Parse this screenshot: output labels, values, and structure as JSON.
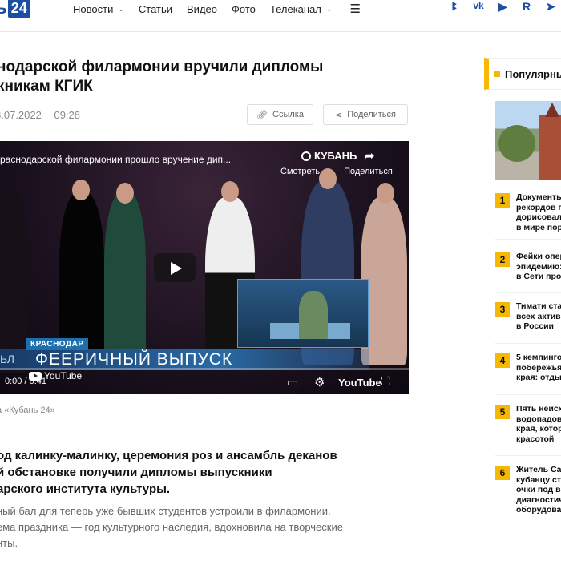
{
  "header": {
    "logo_text": "ь",
    "logo_badge": "24",
    "nav": [
      {
        "label": "Новости",
        "dropdown": true
      },
      {
        "label": "Статьи",
        "dropdown": false
      },
      {
        "label": "Видео",
        "dropdown": false
      },
      {
        "label": "Фото",
        "dropdown": false
      },
      {
        "label": "Телеканал",
        "dropdown": true
      }
    ],
    "burger": "☰",
    "socials": [
      "ok",
      "vk",
      "▶",
      "R",
      "tg"
    ]
  },
  "article": {
    "title_line1": "нодарской филармонии вручили дипломы",
    "title_line2": "кникам КГИК",
    "date": "8.07.2022",
    "time": "09:28",
    "link_button": "Ссылка",
    "share_button": "Поделиться",
    "caption": "а «Кубань 24»",
    "lead_line1": "од калинку-малинку, церемония роз и ансамбль деканов",
    "lead_line2": "й обстановке получили дипломы выпускники",
    "lead_line3": "арского института культуры.",
    "body_line1": "ный бал для теперь уже бывших студентов устроили в филармонии.",
    "body_line2": "ема праздника — год культурного наследия, вдохновила на творческие",
    "body_line3": "нты."
  },
  "video": {
    "title": "раснодарской филармонии прошло вручение дип...",
    "brand": "КУБАНЬ",
    "watch_label": "Смотреть",
    "share_label": "Поделиться",
    "lower_city": "КРАСНОДАР",
    "lower_prefix": "ЬЛ",
    "lower_headline": "ФЕЕРИЧНЫЙ ВЫПУСК",
    "youtube_mini": "YouTube",
    "time": "0:00 / 0:41",
    "progress": 0,
    "youtube_logo": "YouTube"
  },
  "sidebar": {
    "heading": "Популярные",
    "items": [
      {
        "num": "1",
        "lines": [
          "Документы",
          "рекордов п",
          "дорисовали",
          "в мире пор"
        ]
      },
      {
        "num": "2",
        "lines": [
          "Фейки опер",
          "эпидемию:",
          "в Сети про"
        ]
      },
      {
        "num": "3",
        "lines": [
          "Тимати ста",
          "всех актив",
          "в России"
        ]
      },
      {
        "num": "4",
        "lines": [
          "5 кемпинго",
          "побережья",
          "края: отдых"
        ]
      },
      {
        "num": "5",
        "lines": [
          "Пять неисх",
          "водопадов",
          "края, котор",
          "красотой"
        ]
      },
      {
        "num": "6",
        "lines": [
          "Житель Сам",
          "кубанцу ст",
          "очки под в",
          "диагностич",
          "оборудова"
        ]
      }
    ]
  },
  "colors": {
    "brand_blue": "#1a4fa3",
    "accent_yellow": "#f6b800",
    "muted_text": "#888888"
  },
  "icons": {
    "link": "link-icon",
    "share": "share-icon",
    "play": "play-icon",
    "settings": "gear-icon",
    "fullscreen": "fullscreen-icon",
    "subtitles": "subtitles-icon"
  }
}
